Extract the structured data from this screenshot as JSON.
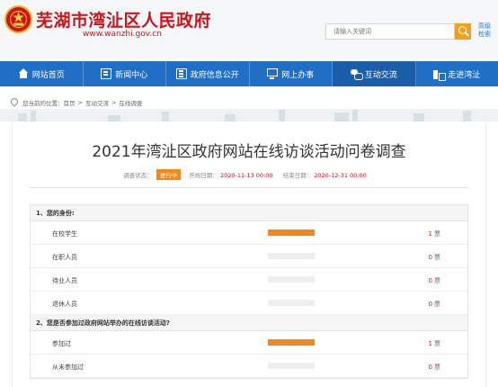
{
  "header": {
    "site_title": "芜湖市湾沚区人民政府",
    "site_url": "www.wanzhi.gov.cn",
    "search_placeholder": "请输入关键词",
    "advanced_search": "高级 检索",
    "brand_color": "#d0121b"
  },
  "nav": {
    "color": "#1f6fc6",
    "items": [
      {
        "label": "网站首页",
        "icon": "home-icon"
      },
      {
        "label": "新闻中心",
        "icon": "news-icon"
      },
      {
        "label": "政府信息公开",
        "icon": "document-icon"
      },
      {
        "label": "网上办事",
        "icon": "monitor-icon"
      },
      {
        "label": "互动交流",
        "icon": "chat-icon",
        "active": true
      },
      {
        "label": "走进湾沚",
        "icon": "building-icon"
      }
    ]
  },
  "breadcrumb": {
    "prefix": "您当前的位置：",
    "items": [
      "首页",
      "互动交流",
      "在线调查"
    ],
    "separator": ">"
  },
  "page": {
    "title": "2021年湾沚区政府网站在线访谈活动问卷调查",
    "status_label": "调查状态：",
    "status_value": "进行中",
    "start_label": "开始日期：",
    "start_date": "2020-11-13 00:00",
    "end_label": "结束日期：",
    "end_date": "2020-12-31 00:00"
  },
  "survey": {
    "vote_unit": "票",
    "questions": [
      {
        "title": "1、您的身份:",
        "options": [
          {
            "label": "在校学生",
            "votes": 1,
            "share": 1.0
          },
          {
            "label": "在职人员",
            "votes": 0,
            "share": 0
          },
          {
            "label": "待业人员",
            "votes": 0,
            "share": 0
          },
          {
            "label": "退休人员",
            "votes": 0,
            "share": 0
          }
        ]
      },
      {
        "title": "2、您是否参加过政府网站举办的在线访谈活动?",
        "options": [
          {
            "label": "参加过",
            "votes": 1,
            "share": 1.0
          },
          {
            "label": "从未参加过",
            "votes": 0,
            "share": 0
          }
        ]
      }
    ]
  }
}
